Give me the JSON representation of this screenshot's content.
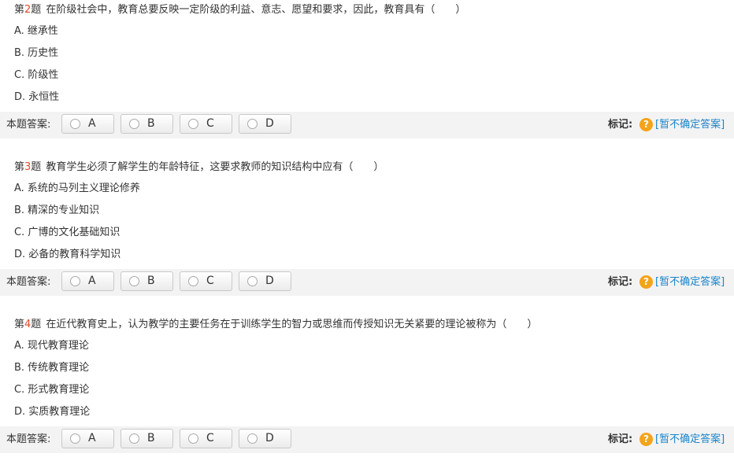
{
  "questions": [
    {
      "prefix": "第",
      "num": "2",
      "suffix": "题",
      "text": "在阶级社会中，教育总要反映一定阶级的利益、意志、愿望和要求，因此，教育具有（　　）",
      "options": [
        "A. 继承性",
        "B. 历史性",
        "C. 阶级性",
        "D. 永恒性"
      ]
    },
    {
      "prefix": "第",
      "num": "3",
      "suffix": "题",
      "text": "教育学生必须了解学生的年龄特征，这要求教师的知识结构中应有（　　）",
      "options": [
        "A. 系统的马列主义理论修养",
        "B. 精深的专业知识",
        "C. 广博的文化基础知识",
        "D. 必备的教育科学知识"
      ]
    },
    {
      "prefix": "第",
      "num": "4",
      "suffix": "题",
      "text": "在近代教育史上，认为教学的主要任务在于训练学生的智力或思维而传授知识无关紧要的理论被称为（　　）",
      "options": [
        "A. 现代教育理论",
        "B. 传统教育理论",
        "C. 形式教育理论",
        "D. 实质教育理论"
      ]
    }
  ],
  "answer_bar": {
    "label": "本题答案:",
    "choices": [
      "A",
      "B",
      "C",
      "D"
    ],
    "mark_label": "标记:",
    "help_icon": "question-mark-icon",
    "help_glyph": "?",
    "mark_link": "[暂不确定答案]"
  },
  "colors": {
    "question_number": "#e24a2b",
    "link": "#1a84c9",
    "help_icon": "#f4a31b",
    "bar_background": "#f3f3f3"
  }
}
